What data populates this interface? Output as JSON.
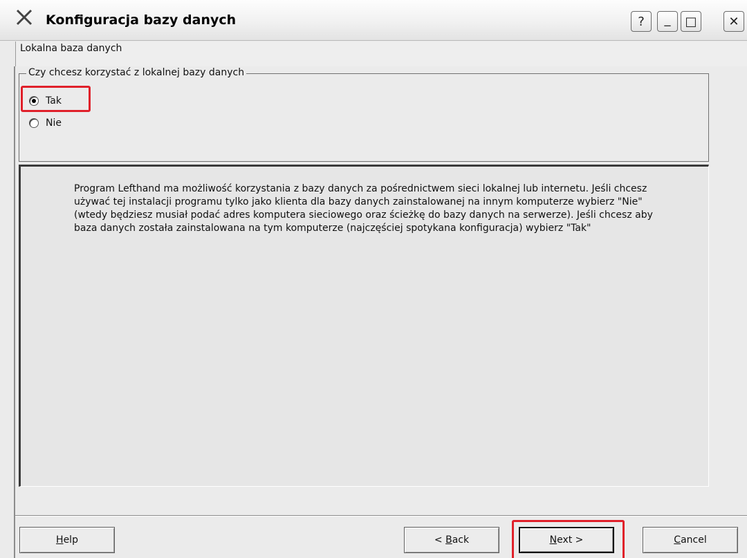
{
  "window": {
    "title": "Konfiguracja bazy danych",
    "controls": {
      "help": "?",
      "minimize": "_",
      "maximize": "□",
      "close": "✕"
    }
  },
  "page_header": "Lokalna baza danych",
  "group": {
    "legend": "Czy chcesz korzystać z lokalnej bazy danych",
    "options": [
      {
        "label": "Tak",
        "selected": true
      },
      {
        "label": "Nie",
        "selected": false
      }
    ]
  },
  "info": {
    "text": "Program Lefthand ma możliwość korzystania z bazy danych za pośrednictwem sieci lokalnej lub internetu. Jeśli chcesz używać tej instalacji programu tylko jako klienta dla bazy danych zainstalowanej na innym komputerze wybierz \"Nie\" (wtedy będziesz musiał podać adres komputera sieciowego oraz ścieżkę do bazy danych na serwerze). Jeśli chcesz aby baza danych została zainstalowana na tym komputerze (najczęściej spotykana konfiguracja) wybierz \"Tak\""
  },
  "buttons": {
    "help": {
      "mnemonic": "H",
      "rest": "elp"
    },
    "back": {
      "prefix": "< ",
      "mnemonic": "B",
      "rest": "ack"
    },
    "next": {
      "mnemonic": "N",
      "rest": "ext >"
    },
    "cancel": {
      "mnemonic": "C",
      "rest": "ancel"
    }
  },
  "colors": {
    "highlight": "#e0202a"
  }
}
